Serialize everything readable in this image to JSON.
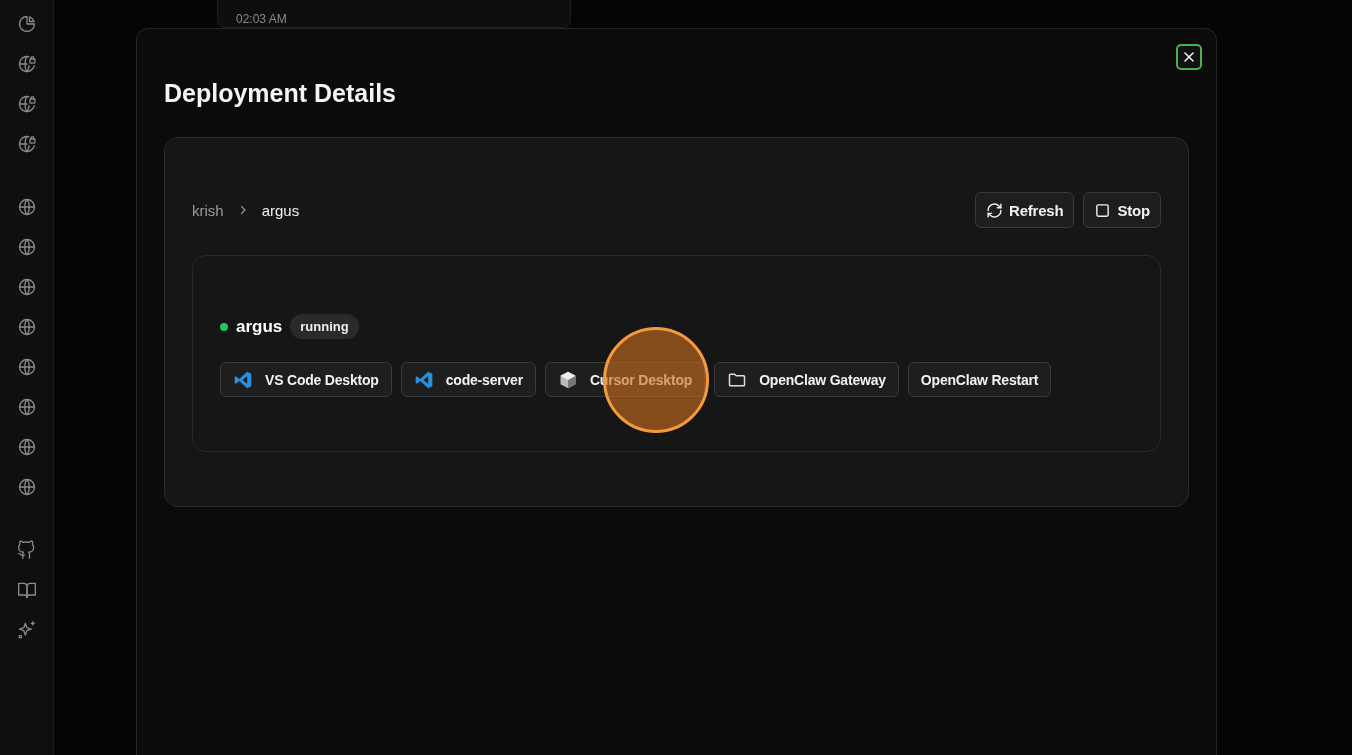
{
  "sidebar": {
    "items": [
      {
        "kind": "chart"
      },
      {
        "kind": "globe-lock"
      },
      {
        "kind": "globe-lock"
      },
      {
        "kind": "globe-lock"
      },
      {
        "kind": "gap"
      },
      {
        "kind": "globe"
      },
      {
        "kind": "globe"
      },
      {
        "kind": "globe"
      },
      {
        "kind": "globe"
      },
      {
        "kind": "globe"
      },
      {
        "kind": "globe"
      },
      {
        "kind": "globe"
      },
      {
        "kind": "globe"
      },
      {
        "kind": "gap"
      },
      {
        "kind": "github"
      },
      {
        "kind": "book"
      },
      {
        "kind": "sparkles"
      }
    ]
  },
  "background_card": {
    "time": "02:03 AM"
  },
  "modal": {
    "title": "Deployment Details",
    "breadcrumb": [
      "krish",
      "argus"
    ],
    "actions": [
      {
        "kind": "refresh",
        "label": "Refresh"
      },
      {
        "kind": "stop",
        "label": "Stop"
      }
    ],
    "deployment": {
      "name": "argus",
      "status": "running",
      "color": "#22c55e",
      "links": [
        {
          "kind": "vscode",
          "label": "VS Code Desktop"
        },
        {
          "kind": "vscode",
          "label": "code-server"
        },
        {
          "kind": "cube",
          "label": "Cursor Desktop"
        },
        {
          "kind": "folder",
          "label": "OpenClaw Gateway"
        },
        {
          "kind": "none",
          "label": "OpenClaw Restart"
        }
      ]
    }
  },
  "click_highlight": true
}
